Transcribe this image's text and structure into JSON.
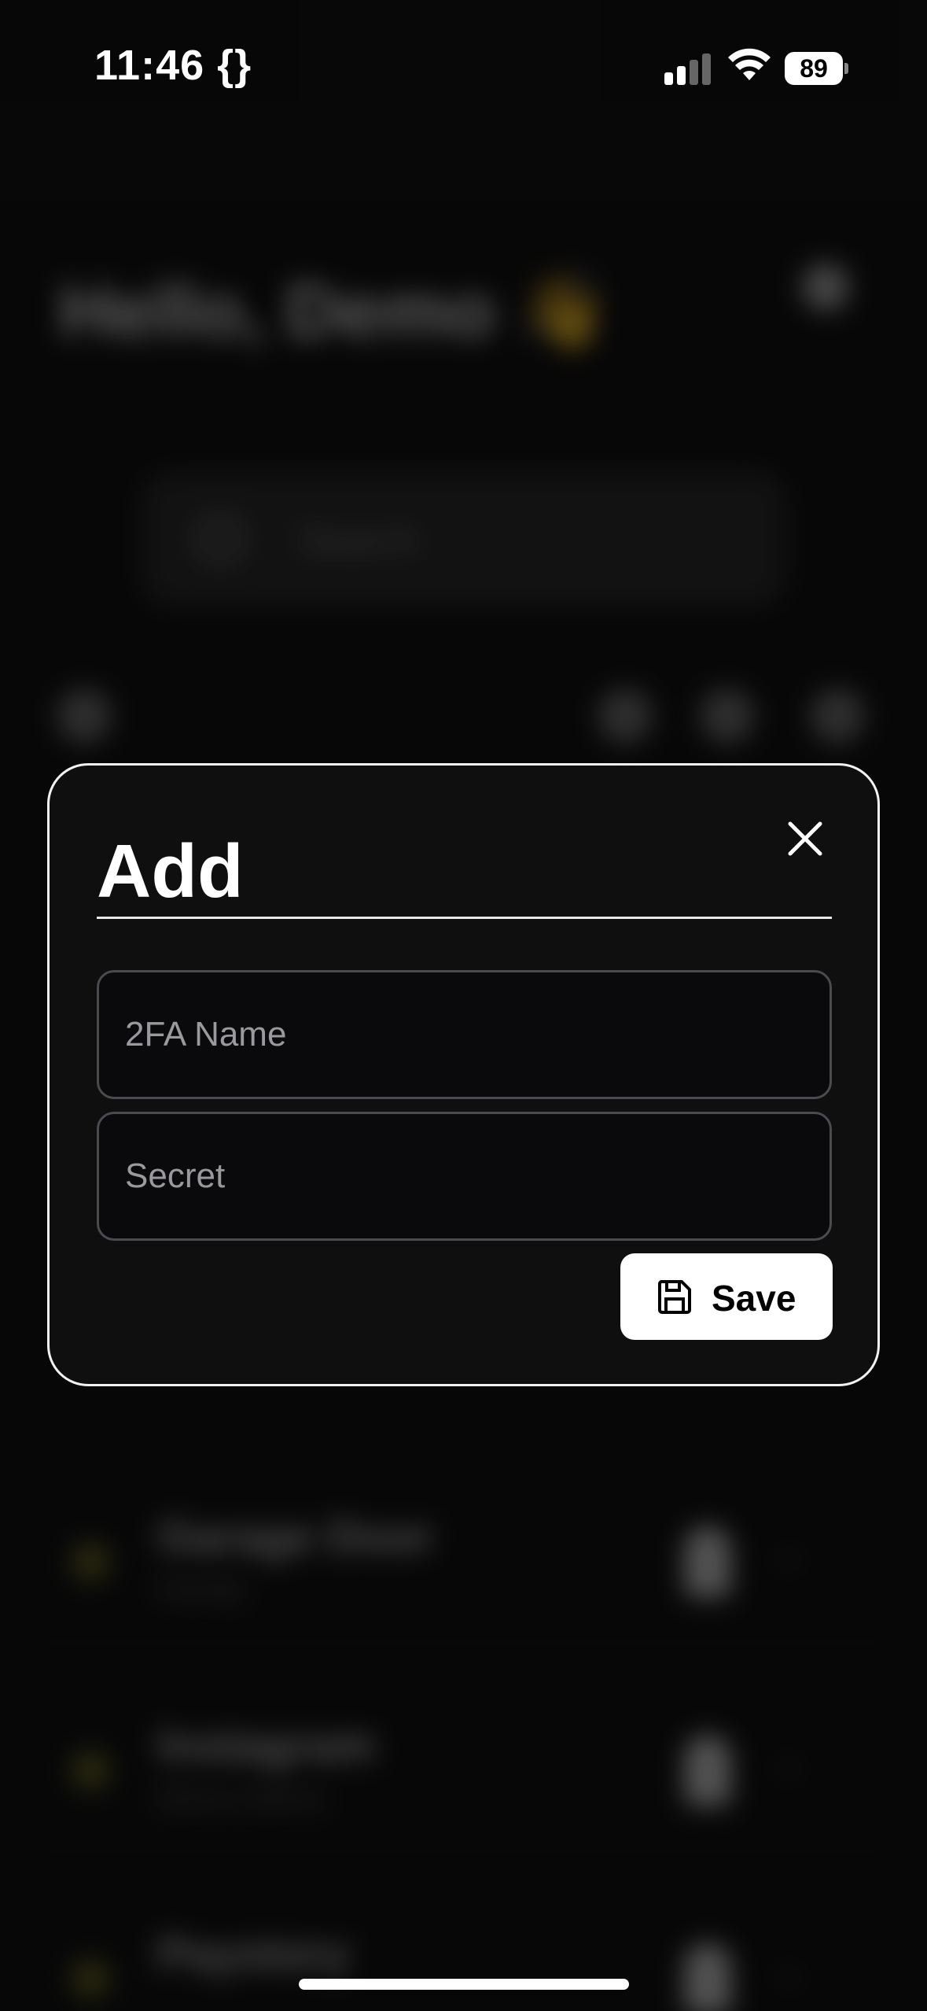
{
  "status_bar": {
    "time": "11:46 {}",
    "battery": "89",
    "icons": [
      "cellular-signal-icon",
      "wifi-icon",
      "battery-icon"
    ]
  },
  "background_app": {
    "greeting": "Hello, Demo",
    "greeting_emoji": "👋",
    "search_placeholder": "Search",
    "entries": [
      {
        "name": "Garage Door",
        "subtitle": "Family",
        "code": "–"
      },
      {
        "name": "Instagram",
        "subtitle": "Demo Demo",
        "code": "–"
      },
      {
        "name": "Paystory",
        "subtitle": "",
        "code": "–"
      }
    ]
  },
  "modal": {
    "title": "Add",
    "name_placeholder": "2FA Name",
    "secret_placeholder": "Secret",
    "save_label": "Save",
    "close_icon": "close-icon",
    "save_icon": "floppy-disk-icon"
  },
  "colors": {
    "background": "#0c0c0d",
    "modal_border": "#f2f2f2",
    "field_border": "#4a4a4f",
    "button_bg": "#ffffff"
  }
}
